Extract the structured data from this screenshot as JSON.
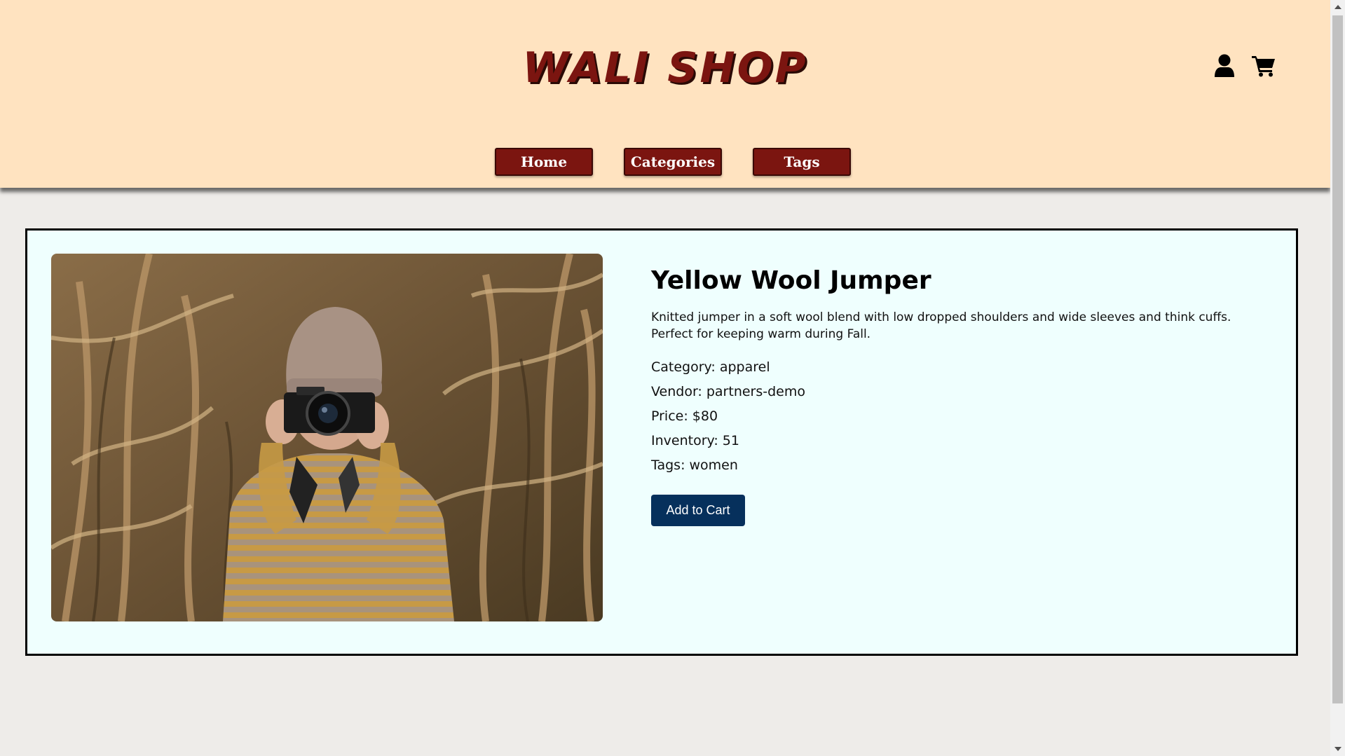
{
  "header": {
    "logo": "WALI SHOP",
    "nav": [
      {
        "label": "Home"
      },
      {
        "label": "Categories"
      },
      {
        "label": "Tags"
      }
    ]
  },
  "product": {
    "title": "Yellow Wool Jumper",
    "description": "Knitted jumper in a soft wool blend with low dropped shoulders and wide sleeves and think cuffs. Perfect for keeping warm during Fall.",
    "category": "Category: apparel",
    "vendor": "Vendor: partners-demo",
    "price": "Price: $80",
    "inventory": "Inventory: 51",
    "tags": "Tags: women",
    "add_to_cart": "Add to Cart"
  },
  "icons": {
    "account": "user-icon",
    "cart": "cart-icon"
  },
  "colors": {
    "header_bg": "#ffe3c0",
    "brand": "#7b1510",
    "card_bg": "#effffe",
    "button": "#06305c"
  }
}
